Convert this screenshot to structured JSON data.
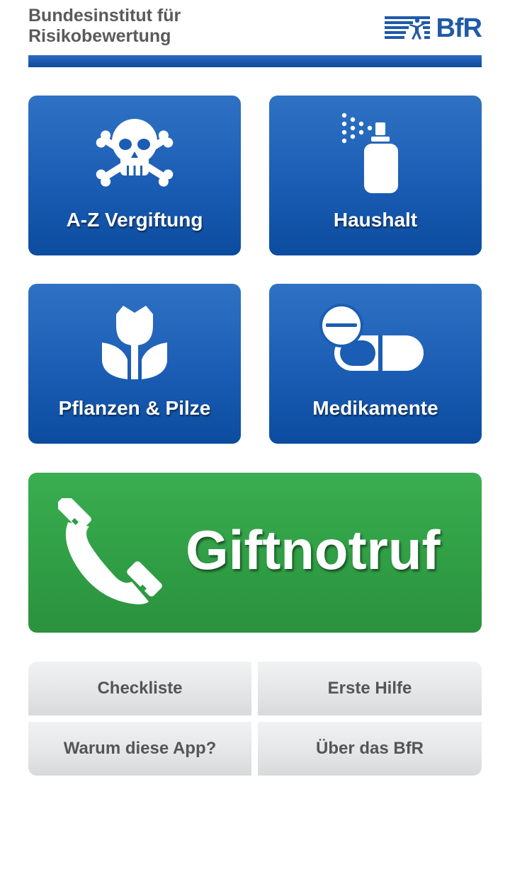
{
  "header": {
    "org_line1": "Bundesinstitut für",
    "org_line2": "Risikobewertung",
    "logo_text": "BfR"
  },
  "tiles": [
    {
      "label": "A-Z Vergiftung",
      "icon": "skull-crossbones-icon"
    },
    {
      "label": "Haushalt",
      "icon": "spray-bottle-icon"
    },
    {
      "label": "Pflanzen & Pilze",
      "icon": "tulip-icon"
    },
    {
      "label": "Medikamente",
      "icon": "pills-icon"
    }
  ],
  "emergency": {
    "label": "Giftnotruf",
    "icon": "phone-icon"
  },
  "buttons": [
    {
      "label": "Checkliste"
    },
    {
      "label": "Erste Hilfe"
    },
    {
      "label": "Warum diese App?"
    },
    {
      "label": "Über das BfR"
    }
  ],
  "colors": {
    "tile_blue": "#1b5db4",
    "emergency_green": "#33a448",
    "header_bar_blue": "#1f5aa8",
    "text_gray": "#5a5a5a"
  }
}
